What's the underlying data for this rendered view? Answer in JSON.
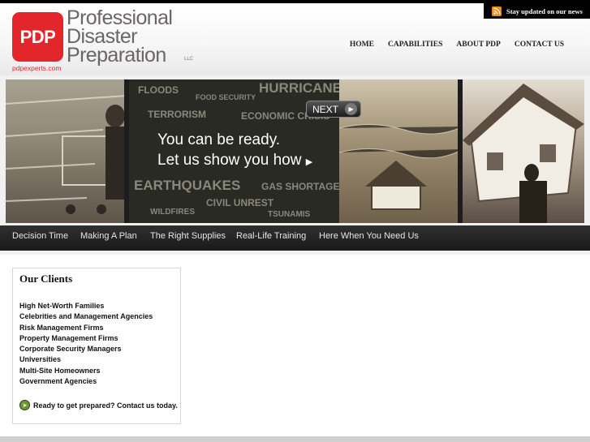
{
  "top_tab": {
    "rss_text": "Stay updated on our news",
    "rss_icon": "rss-icon"
  },
  "logo": {
    "mark": "PDP",
    "name_line1": "Professional",
    "name_line2": "Disaster",
    "name_line3": "Preparation",
    "suffix": "LLC",
    "url": "pdpexperts.com"
  },
  "nav": [
    "HOME",
    "CAPABILITIES",
    "ABOUT PDP",
    "CONTACT US"
  ],
  "banner": {
    "words": [
      "FLOODS",
      "FOOD SECURITY",
      "HURRICANES",
      "TERRORISM",
      "ECONOMIC CRISIS",
      "EARTHQUAKES",
      "GAS SHORTAGES",
      "CIVIL UNREST",
      "WILDFIRES",
      "TSUNAMIS"
    ],
    "tagline_line1": "You can be ready.",
    "tagline_line2": "Let us show you how",
    "next_label": "NEXT"
  },
  "subnav": [
    "Decision Time",
    "Making A Plan",
    "The Right Supplies",
    "Real-Life Training",
    "Here When You Need Us"
  ],
  "clients": {
    "title": "Our Clients",
    "items": [
      "High Net-Worth Families",
      "Celebrities and Management Agencies",
      "Risk Management Firms",
      "Property Management Firms",
      "Corporate Security Managers",
      "Universities",
      "Multi-Site Homeowners",
      "Government Agencies"
    ],
    "cta": "Ready to get prepared? Contact us today."
  },
  "colors": {
    "brand_red": "#e3262b",
    "rss_orange": "#f28a1a",
    "nav_dark": "#1a1a1a"
  }
}
